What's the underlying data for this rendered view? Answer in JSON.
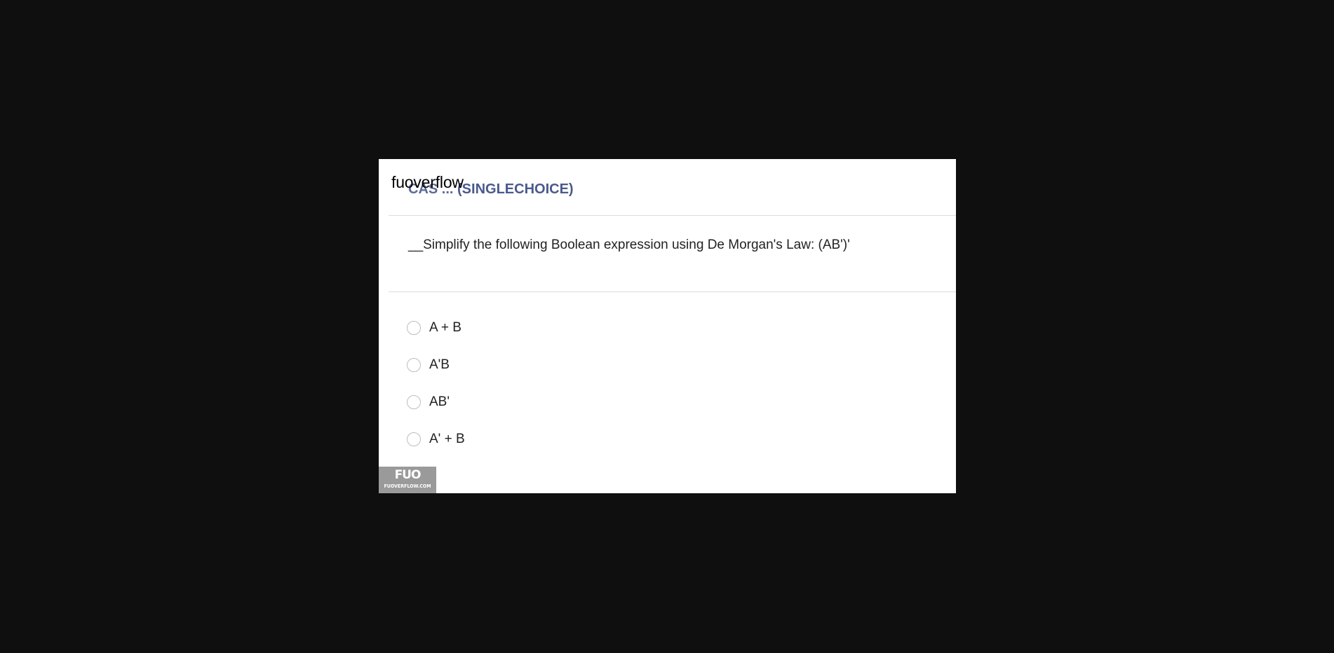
{
  "watermark": {
    "top_text": "fuoverflow",
    "logo_mark": "FUO",
    "logo_sub": "FUOVERFLOW.COM"
  },
  "question": {
    "code": "CAS ... (SINGLECHOICE)",
    "code_visible": "(SINGLECHOICE)",
    "text": "__Simplify the following Boolean expression using De Morgan's Law: (AB')'"
  },
  "options": [
    {
      "label": "A + B",
      "selected": false
    },
    {
      "label": "A'B",
      "selected": false
    },
    {
      "label": "AB'",
      "selected": false
    },
    {
      "label": "A' + B",
      "selected": false
    }
  ],
  "colors": {
    "background": "#0f0f0f",
    "card": "#ffffff",
    "question_code": "#4a5a8c",
    "divider": "#dcdcdc",
    "logo_bg": "#9a9a9a"
  }
}
